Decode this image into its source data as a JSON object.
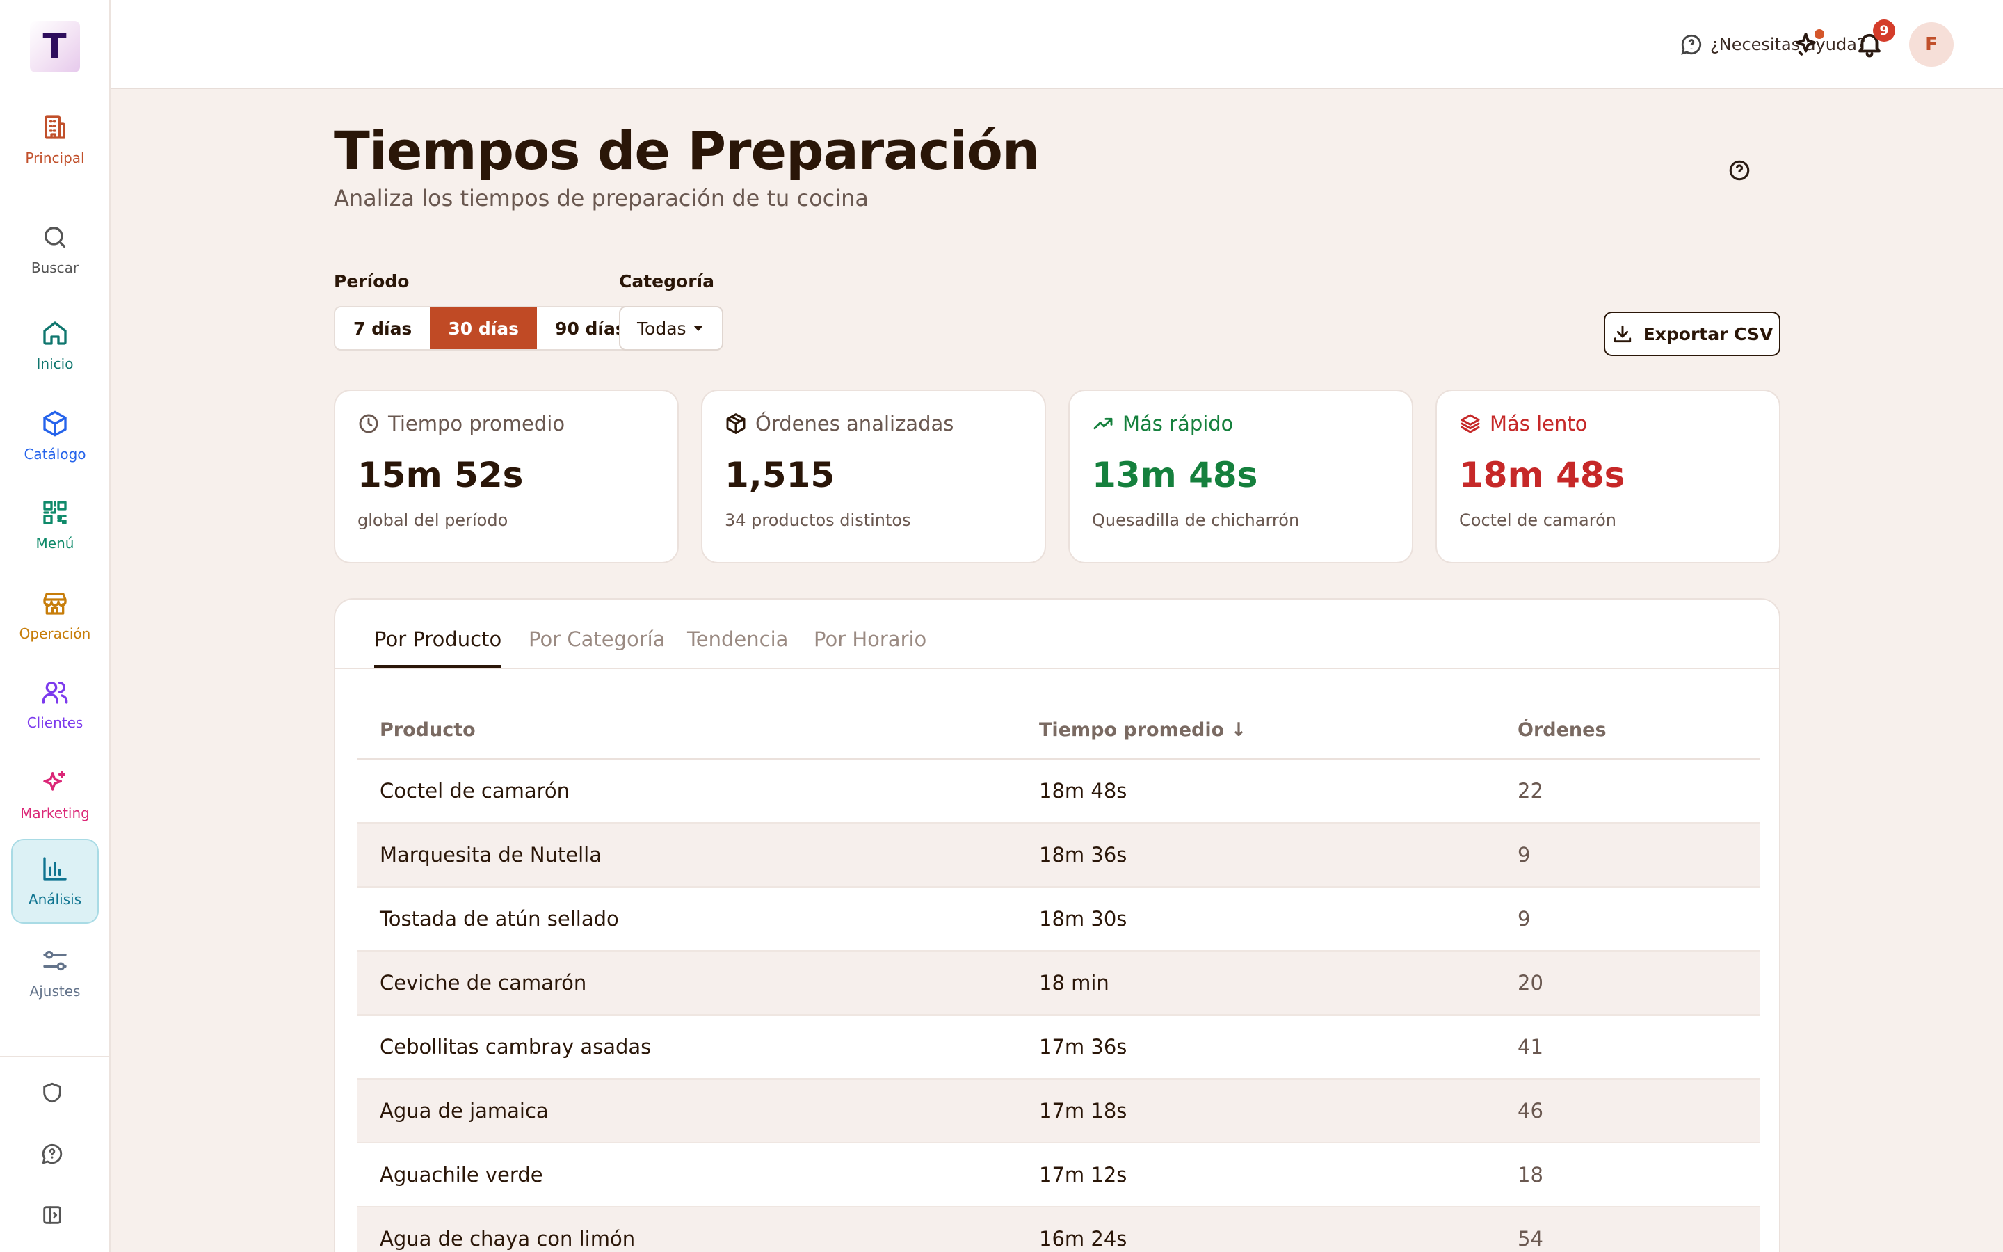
{
  "app": {
    "logo_letter": "T"
  },
  "sidebar": {
    "items": [
      {
        "label": "Principal",
        "color": "#c1502b"
      },
      {
        "label": "Buscar",
        "color": "#555555"
      },
      {
        "label": "Inicio",
        "color": "#0f766e"
      },
      {
        "label": "Catálogo",
        "color": "#2563eb"
      },
      {
        "label": "Menú",
        "color": "#0f8a6a"
      },
      {
        "label": "Operación",
        "color": "#c77d0a"
      },
      {
        "label": "Clientes",
        "color": "#7c3aed"
      },
      {
        "label": "Marketing",
        "color": "#db2777"
      },
      {
        "label": "Análisis",
        "color": "#0e7490",
        "active": true
      },
      {
        "label": "Ajustes",
        "color": "#64748b"
      }
    ],
    "bottom_icons": [
      "shield-icon",
      "chat-help-icon",
      "collapse-sidebar-icon"
    ]
  },
  "topbar": {
    "help_label": "¿Necesitas ayuda?",
    "notifications_count": "9",
    "avatar_initial": "F"
  },
  "page": {
    "title": "Tiempos de Preparación",
    "subtitle": "Analiza los tiempos de preparación de tu cocina"
  },
  "filters": {
    "period_label": "Período",
    "period_options": [
      "7 días",
      "30 días",
      "90 días"
    ],
    "period_selected": "30 días",
    "category_label": "Categoría",
    "category_value": "Todas"
  },
  "export_label": "Exportar CSV",
  "stats": [
    {
      "title": "Tiempo promedio",
      "value": "15m 52s",
      "sub": "global del período",
      "icon": "clock-icon",
      "color": "#2a1608",
      "title_color": "#6a5850"
    },
    {
      "title": "Órdenes analizadas",
      "value": "1,515",
      "sub": "34 productos distintos",
      "icon": "box-icon",
      "color": "#2a1608",
      "title_color": "#6a5850"
    },
    {
      "title": "Más rápido",
      "value": "13m 48s",
      "sub": "Quesadilla de chicharrón",
      "icon": "trending-up-icon",
      "color": "#15803d",
      "title_color": "#15803d"
    },
    {
      "title": "Más lento",
      "value": "18m 48s",
      "sub": "Coctel de camarón",
      "icon": "layers-icon",
      "color": "#c62828",
      "title_color": "#c62828"
    }
  ],
  "tabs": [
    "Por Producto",
    "Por Categoría",
    "Tendencia",
    "Por Horario"
  ],
  "table": {
    "headers": [
      "Producto",
      "Tiempo promedio ↓",
      "Órdenes"
    ],
    "rows": [
      [
        "Coctel de camarón",
        "18m 48s",
        "22"
      ],
      [
        "Marquesita de Nutella",
        "18m 36s",
        "9"
      ],
      [
        "Tostada de atún sellado",
        "18m 30s",
        "9"
      ],
      [
        "Ceviche de camarón",
        "18 min",
        "20"
      ],
      [
        "Cebollitas cambray asadas",
        "17m 36s",
        "41"
      ],
      [
        "Agua de jamaica",
        "17m 18s",
        "46"
      ],
      [
        "Aguachile verde",
        "17m 12s",
        "18"
      ],
      [
        "Agua de chaya con limón",
        "16m 24s",
        "54"
      ]
    ]
  }
}
